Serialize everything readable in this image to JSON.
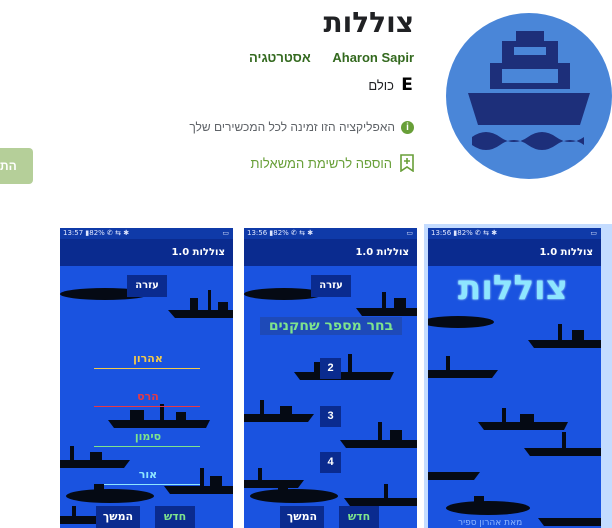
{
  "app": {
    "title": "צוללות",
    "developer": "Aharon Sapir",
    "category": "אסטרטגיה",
    "rating_label": "כולם",
    "availability": "האפליקציה הזו זמינה לכל המכשירים שלך",
    "wishlist": "הוספה לרשימת המשאלות",
    "install_label": "הת",
    "colors": {
      "accent_green": "#689f38",
      "developer_green": "#33691e",
      "install_bg": "#b5cf99",
      "icon_bg": "#4a86d8",
      "icon_ship": "#1d2f7a",
      "screen_blue": "#1a53e0",
      "screen_bar": "#0a2b8f"
    },
    "icons": {
      "app_icon": "ship-icon",
      "rating": "esrb-everyone-icon",
      "info": "info-icon",
      "wishlist": "bookmark-add-icon"
    }
  },
  "screenshots": [
    {
      "status_left": "13:57 ▮82% ✆ ⇆ ✱",
      "status_right": "▭",
      "app_bar": "צוללות 1.0",
      "help": "עזרה",
      "players": [
        "אהרון",
        "הרס",
        "סימון",
        "אור"
      ],
      "player_colors": [
        "#f2c94c",
        "#e63946",
        "#7ee38d",
        "#8ee6ff"
      ],
      "continue": "המשך",
      "new_game": "חדש"
    },
    {
      "status_left": "13:56 ▮82% ✆ ⇆ ✱",
      "status_right": "▭",
      "app_bar": "צוללות 1.0",
      "help": "עזרה",
      "choose_players": "בחר מספר שחקנים",
      "options": [
        "2",
        "3",
        "4"
      ],
      "continue": "המשך",
      "new_game": "חדש"
    },
    {
      "status_left": "13:56 ▮82% ✆ ⇆ ✱",
      "status_right": "▭",
      "app_bar": "צוללות 1.0",
      "splash_title": "צוללות",
      "credit": "מאת אהרון ספיר"
    }
  ]
}
